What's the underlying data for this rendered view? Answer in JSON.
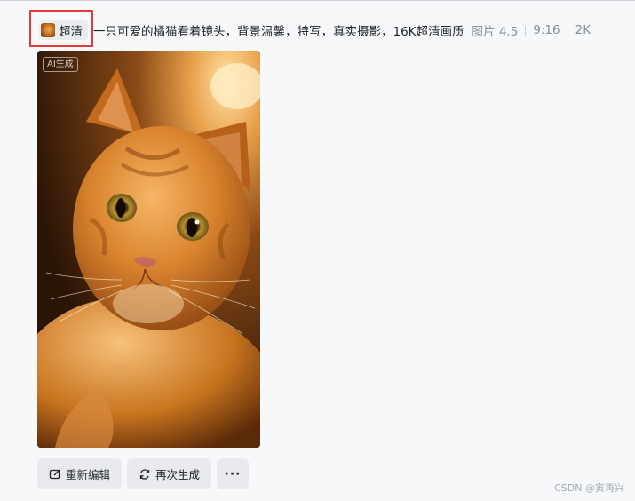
{
  "header": {
    "chip_label": "超清",
    "chip_icon": "cat-thumbnail-icon",
    "prompt": "一只可爱的橘猫看着镜头，背景温馨，特写，真实摄影，16K超清画质",
    "model": "图片 4.5",
    "ratio": "9:16",
    "resolution": "2K"
  },
  "image": {
    "badge": "AI生成",
    "alt": "橘猫"
  },
  "actions": {
    "reedit_label": "重新编辑",
    "regenerate_label": "再次生成",
    "more_label": "···"
  },
  "footer": {
    "watermark": "CSDN @寅再兴"
  },
  "colors": {
    "highlight": "#e33b3b",
    "background": "#f7f8fa",
    "button_bg": "#e8eaee"
  }
}
